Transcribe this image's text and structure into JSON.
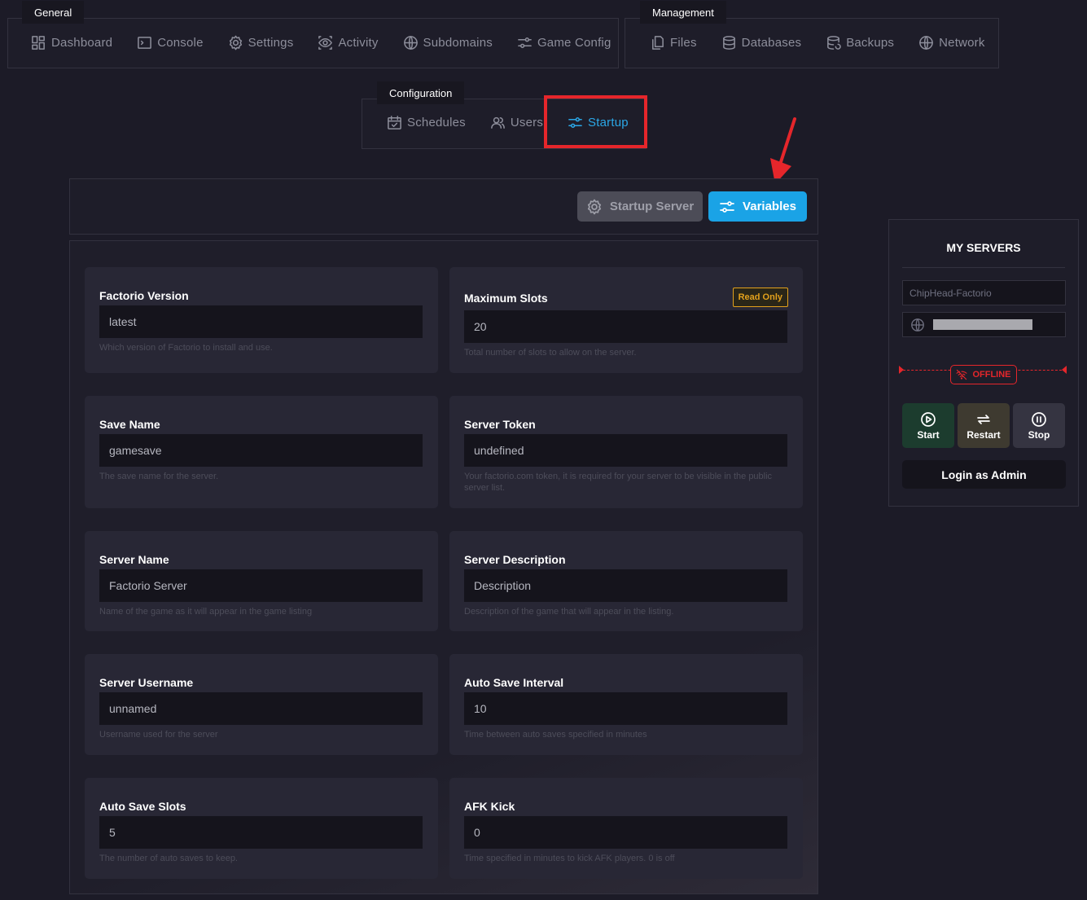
{
  "nav": {
    "general": {
      "label": "General",
      "items": [
        {
          "label": "Dashboard",
          "icon": "dashboard-icon"
        },
        {
          "label": "Console",
          "icon": "console-icon"
        },
        {
          "label": "Settings",
          "icon": "gear-icon"
        },
        {
          "label": "Activity",
          "icon": "eye-icon"
        },
        {
          "label": "Subdomains",
          "icon": "globe-icon"
        },
        {
          "label": "Game Config",
          "icon": "sliders-icon"
        }
      ]
    },
    "management": {
      "label": "Management",
      "items": [
        {
          "label": "Files",
          "icon": "files-icon"
        },
        {
          "label": "Databases",
          "icon": "database-icon"
        },
        {
          "label": "Backups",
          "icon": "backup-icon"
        },
        {
          "label": "Network",
          "icon": "globe-icon"
        }
      ]
    },
    "configuration": {
      "label": "Configuration",
      "items": [
        {
          "label": "Schedules",
          "icon": "calendar-icon"
        },
        {
          "label": "Users",
          "icon": "users-icon"
        },
        {
          "label": "Startup",
          "icon": "sliders-icon",
          "active": true
        }
      ]
    }
  },
  "toolbar": {
    "startup_server_label": "Startup Server",
    "variables_label": "Variables"
  },
  "variables": [
    {
      "title": "Factorio Version",
      "value": "latest",
      "description": "Which version of Factorio to install and use."
    },
    {
      "title": "Maximum Slots",
      "value": "20",
      "description": "Total number of slots to allow on the server.",
      "badge": "Read Only"
    },
    {
      "title": "Save Name",
      "value": "gamesave",
      "description": "The save name for the server."
    },
    {
      "title": "Server Token",
      "value": "undefined",
      "description": "Your factorio.com token, it is required for your server to be visible in the public server list."
    },
    {
      "title": "Server Name",
      "value": "Factorio Server",
      "description": "Name of the game as it will appear in the game listing"
    },
    {
      "title": "Server Description",
      "value": "Description",
      "description": "Description of the game that will appear in the listing."
    },
    {
      "title": "Server Username",
      "value": "unnamed",
      "description": "Username used for the server"
    },
    {
      "title": "Auto Save Interval",
      "value": "10",
      "description": "Time between auto saves specified in minutes"
    },
    {
      "title": "Auto Save Slots",
      "value": "5",
      "description": "The number of auto saves to keep."
    },
    {
      "title": "AFK Kick",
      "value": "0",
      "description": "Time specified in minutes to kick AFK players. 0 is off"
    }
  ],
  "servers": {
    "title": "MY SERVERS",
    "server_name": "ChipHead-Factorio",
    "status": "OFFLINE",
    "start_label": "Start",
    "restart_label": "Restart",
    "stop_label": "Stop",
    "login_label": "Login as Admin"
  },
  "colors": {
    "accent": "#1aa3e6",
    "highlight": "#e5262b",
    "readonly": "#e2a11c",
    "background": "#1c1b27"
  }
}
